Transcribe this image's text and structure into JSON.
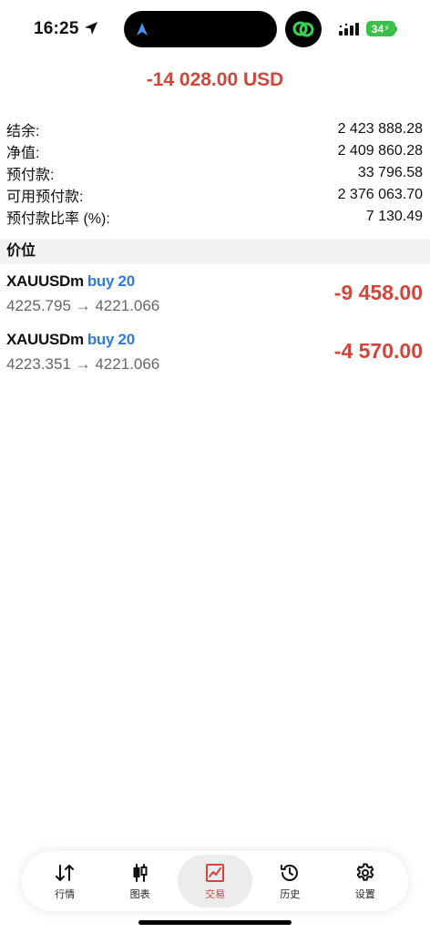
{
  "status_bar": {
    "time": "16:25",
    "battery": "34"
  },
  "total": "-14 028.00 USD",
  "summary": [
    {
      "label": "结余:",
      "value": "2 423 888.28"
    },
    {
      "label": "净值:",
      "value": "2 409 860.28"
    },
    {
      "label": "预付款:",
      "value": "33 796.58"
    },
    {
      "label": "可用预付款:",
      "value": "2 376 063.70"
    },
    {
      "label": "预付款比率 (%):",
      "value": "7 130.49"
    }
  ],
  "positions_header": "价位",
  "positions": [
    {
      "symbol": "XAUUSDm",
      "direction": "buy 20",
      "prices": "4225.795 → 4221.066",
      "profit": "-9 458.00"
    },
    {
      "symbol": "XAUUSDm",
      "direction": "buy 20",
      "prices": "4223.351 → 4221.066",
      "profit": "-4 570.00"
    }
  ],
  "tabs": [
    {
      "label": "行情",
      "icon": "sort-arrows-icon"
    },
    {
      "label": "图表",
      "icon": "candlestick-icon"
    },
    {
      "label": "交易",
      "icon": "trade-chart-icon",
      "active": true
    },
    {
      "label": "历史",
      "icon": "history-icon"
    },
    {
      "label": "设置",
      "icon": "gear-icon"
    }
  ],
  "colors": {
    "loss": "#d0463a",
    "buy": "#2f7bd6",
    "battery": "#3ac04a"
  }
}
